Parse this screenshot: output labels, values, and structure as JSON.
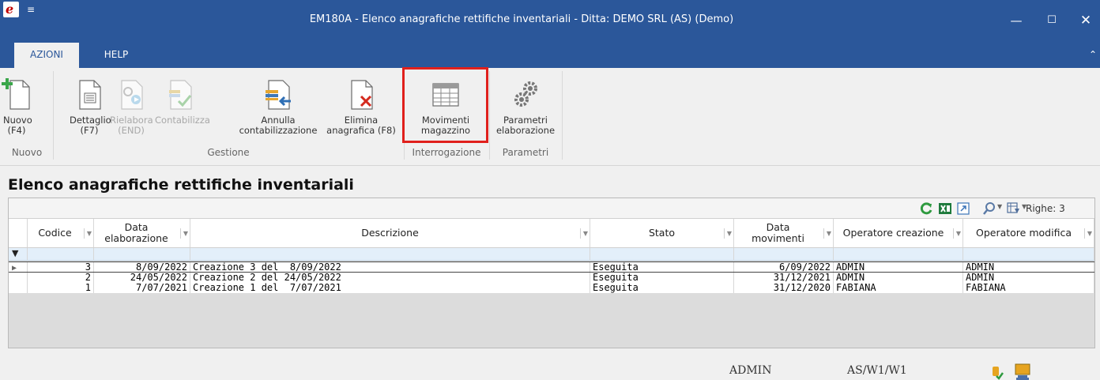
{
  "window": {
    "title": "EM180A - Elenco anagrafiche rettifiche inventariali - Ditta: DEMO SRL (AS) (Demo)",
    "logo_letter": "e",
    "qat": "≡",
    "min": "—",
    "max": "☐",
    "close": "✕"
  },
  "tabs": [
    {
      "label": "AZIONI",
      "active": true
    },
    {
      "label": "HELP",
      "active": false
    }
  ],
  "ribbon": {
    "groups": [
      {
        "label": "Nuovo"
      },
      {
        "label": "Gestione"
      },
      {
        "label": "Interrogazione"
      },
      {
        "label": "Parametri"
      }
    ],
    "buttons": {
      "nuovo": {
        "line1": "Nuovo",
        "line2": "(F4)",
        "icon": "new-document-icon"
      },
      "dettaglio": {
        "line1": "Dettaglio",
        "line2": "(F7)",
        "icon": "detail-document-icon"
      },
      "rielabora": {
        "line1": "Rielabora",
        "line2": "(END)",
        "icon": "reprocess-icon"
      },
      "contabilizza": {
        "line1": "Contabilizza",
        "line2": "",
        "icon": "post-accounting-icon"
      },
      "annulla": {
        "line1": "Annulla",
        "line2": "contabilizzazione",
        "icon": "cancel-accounting-icon"
      },
      "elimina": {
        "line1": "Elimina",
        "line2": "anagrafica (F8)",
        "icon": "delete-document-icon"
      },
      "movimenti": {
        "line1": "Movimenti",
        "line2": "magazzino",
        "icon": "table-icon"
      },
      "parametri": {
        "line1": "Parametri",
        "line2": "elaborazione",
        "icon": "gears-icon"
      }
    }
  },
  "page": {
    "heading": "Elenco anagrafiche rettifiche inventariali"
  },
  "grid": {
    "righe_label": "Righe: 3",
    "columns": {
      "codice": "Codice",
      "data_elab_1": "Data",
      "data_elab_2": "elaborazione",
      "descrizione": "Descrizione",
      "stato": "Stato",
      "data_mov_1": "Data",
      "data_mov_2": "movimenti",
      "op_creazione": "Operatore creazione",
      "op_modifica": "Operatore modifica"
    },
    "rows": [
      {
        "codice": "3",
        "data_elaborazione": "8/09/2022",
        "descrizione": "Creazione 3 del  8/09/2022",
        "stato": "Eseguita",
        "data_movimenti": "6/09/2022",
        "operatore_creazione": "ADMIN",
        "operatore_modifica": "ADMIN"
      },
      {
        "codice": "2",
        "data_elaborazione": "24/05/2022",
        "descrizione": "Creazione 2 del 24/05/2022",
        "stato": "Eseguita",
        "data_movimenti": "31/12/2021",
        "operatore_creazione": "ADMIN",
        "operatore_modifica": "ADMIN"
      },
      {
        "codice": "1",
        "data_elaborazione": "7/07/2021",
        "descrizione": "Creazione 1 del  7/07/2021",
        "stato": "Eseguita",
        "data_movimenti": "31/12/2020",
        "operatore_creazione": "FABIANA",
        "operatore_modifica": "FABIANA"
      }
    ]
  },
  "status": {
    "user": "ADMIN",
    "location": "AS/W1/W1"
  },
  "colors": {
    "titlebar": "#2b579a",
    "highlight": "#e0201c",
    "filter_row": "#e3effa"
  }
}
